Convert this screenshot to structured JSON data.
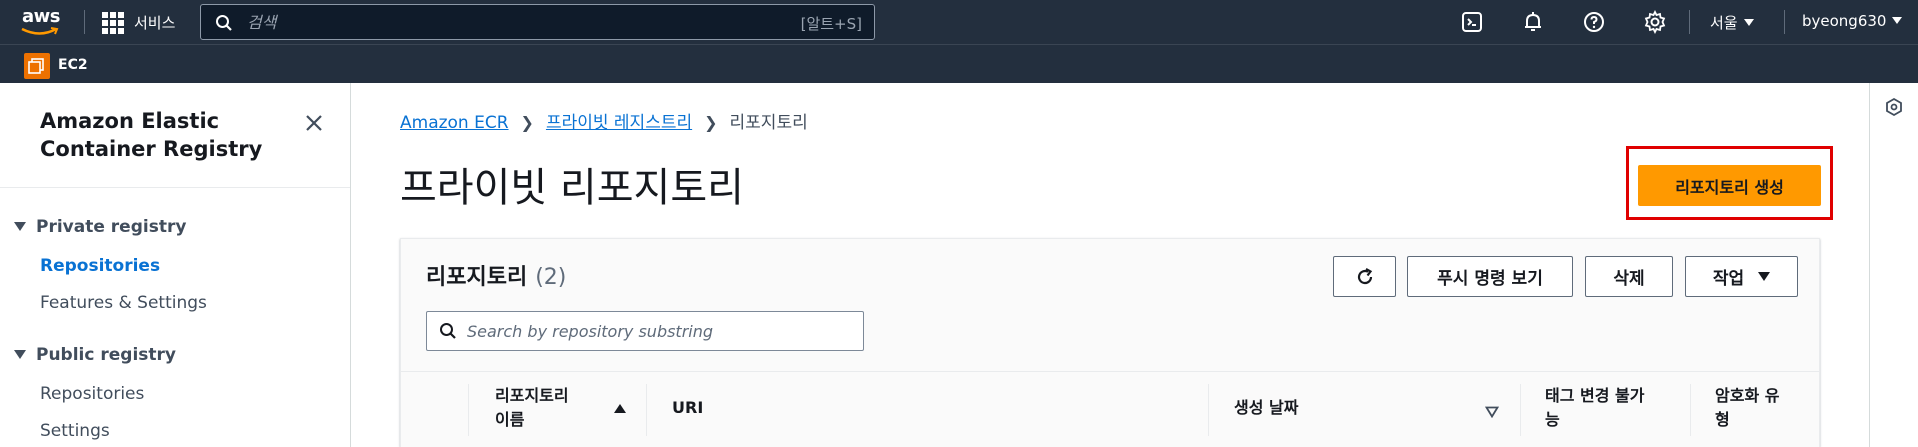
{
  "topnav": {
    "logo": "aws",
    "services_label": "서비스",
    "search_placeholder": "검색",
    "search_shortcut": "[알트+S]",
    "icons": [
      "cloudshell-icon",
      "notifications-icon",
      "help-icon",
      "settings-icon"
    ],
    "region": "서울",
    "user": "byeong630"
  },
  "subnav": {
    "service_label": "EC2"
  },
  "sidebar": {
    "title": "Amazon Elastic Container Registry",
    "sections": [
      {
        "label": "Private registry",
        "items": [
          {
            "label": "Repositories",
            "active": true
          },
          {
            "label": "Features & Settings",
            "active": false
          }
        ]
      },
      {
        "label": "Public registry",
        "items": [
          {
            "label": "Repositories",
            "active": false
          },
          {
            "label": "Settings",
            "active": false
          }
        ]
      }
    ]
  },
  "breadcrumb": {
    "items": [
      "Amazon ECR",
      "프라이빗 레지스트리",
      "리포지토리"
    ]
  },
  "page": {
    "title": "프라이빗 리포지토리",
    "create_button": "리포지토리 생성"
  },
  "panel": {
    "title": "리포지토리",
    "count": "(2)",
    "buttons": {
      "push_commands": "푸시 명령 보기",
      "delete": "삭제",
      "actions": "작업"
    },
    "search_placeholder": "Search by repository substring",
    "columns": {
      "name_line1": "리포지토리",
      "name_line2": "이름",
      "uri": "URI",
      "created": "생성 날짜",
      "tag_line1": "태그 변경 불가",
      "tag_line2": "능",
      "encryption_line1": "암호화 유",
      "encryption_line2": "형"
    }
  },
  "colors": {
    "nav_bg": "#232f3e",
    "primary": "#ff9900",
    "link": "#0972d3",
    "highlight": "#e00000"
  }
}
